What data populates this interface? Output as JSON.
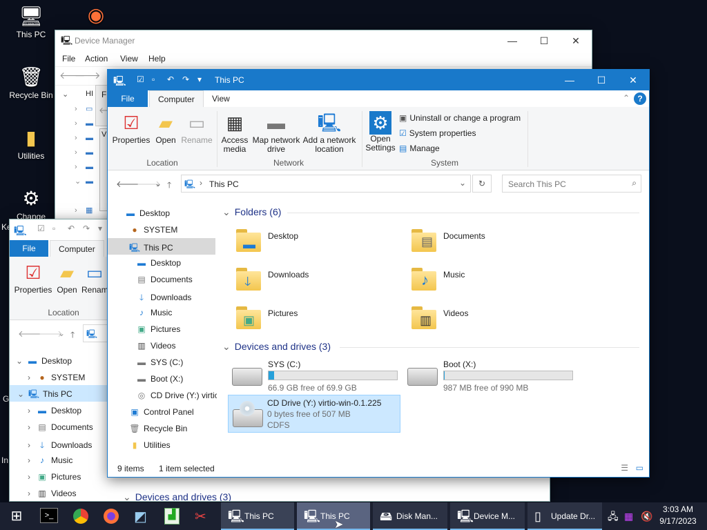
{
  "desktop": {
    "icons": [
      {
        "label": "This PC"
      },
      {
        "label": ""
      },
      {
        "label": "Recycle Bin"
      },
      {
        "label": "Utilities"
      },
      {
        "label": "Change"
      }
    ],
    "edge_fragments": [
      "Ke",
      "G",
      "In"
    ]
  },
  "device_manager": {
    "title": "Device Manager",
    "menu": [
      "File",
      "Action",
      "View",
      "Help"
    ],
    "tree_fragment": "HI",
    "tab_fragment": "Fi",
    "list_fragment": "V"
  },
  "explorer_back": {
    "tabs": {
      "file": "File",
      "computer": "Computer"
    },
    "buttons": {
      "properties": "Properties",
      "open": "Open",
      "rename": "Renam"
    },
    "group": "Location",
    "tree": [
      {
        "label": "Desktop"
      },
      {
        "label": "SYSTEM"
      },
      {
        "label": "This PC"
      },
      {
        "label": "Desktop"
      },
      {
        "label": "Documents"
      },
      {
        "label": "Downloads"
      },
      {
        "label": "Music"
      },
      {
        "label": "Pictures"
      },
      {
        "label": "Videos"
      }
    ],
    "section": "Devices and drives (3)"
  },
  "explorer": {
    "title": "This PC",
    "tabs": {
      "file": "File",
      "computer": "Computer",
      "view": "View"
    },
    "ribbon": {
      "properties": "Properties",
      "open": "Open",
      "rename": "Rename",
      "location_group": "Location",
      "access_media": "Access media",
      "map_drive": "Map network drive",
      "add_location": "Add a network location",
      "network_group": "Network",
      "open_settings": "Open Settings",
      "uninstall": "Uninstall or change a program",
      "sysprops": "System properties",
      "manage": "Manage",
      "system_group": "System"
    },
    "address": "This PC",
    "search_placeholder": "Search This PC",
    "nav": [
      {
        "label": "Desktop"
      },
      {
        "label": "SYSTEM"
      },
      {
        "label": "This PC"
      },
      {
        "label": "Desktop"
      },
      {
        "label": "Documents"
      },
      {
        "label": "Downloads"
      },
      {
        "label": "Music"
      },
      {
        "label": "Pictures"
      },
      {
        "label": "Videos"
      },
      {
        "label": "SYS (C:)"
      },
      {
        "label": "Boot (X:)"
      },
      {
        "label": "CD Drive (Y:) virtic"
      },
      {
        "label": "Control Panel"
      },
      {
        "label": "Recycle Bin"
      },
      {
        "label": "Utilities"
      }
    ],
    "folders_header": "Folders (6)",
    "folders": [
      {
        "label": "Desktop"
      },
      {
        "label": "Documents"
      },
      {
        "label": "Downloads"
      },
      {
        "label": "Music"
      },
      {
        "label": "Pictures"
      },
      {
        "label": "Videos"
      }
    ],
    "drives_header": "Devices and drives (3)",
    "drives": [
      {
        "name": "SYS (C:)",
        "free": "66.9 GB free of 69.9 GB",
        "used_fraction": 0.043
      },
      {
        "name": "Boot (X:)",
        "free": "987 MB free of 990 MB",
        "used_fraction": 0.003
      },
      {
        "name": "CD Drive (Y:) virtio-win-0.1.225",
        "free": "0 bytes free of 507 MB",
        "fs": "CDFS"
      }
    ],
    "status": {
      "items": "9 items",
      "selected": "1 item selected"
    }
  },
  "taskbar": {
    "buttons": [
      {
        "label": "This PC"
      },
      {
        "label": "This PC"
      },
      {
        "label": "Disk Man..."
      },
      {
        "label": "Device M..."
      },
      {
        "label": "Update Dr..."
      }
    ],
    "time": "3:03 AM",
    "date": "9/17/2023"
  }
}
